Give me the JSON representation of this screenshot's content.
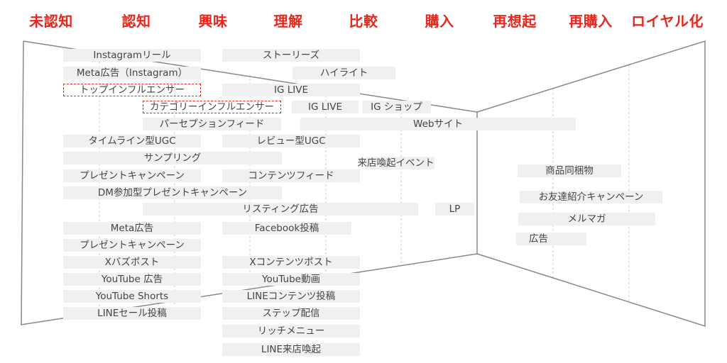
{
  "stages": [
    "未認知",
    "認知",
    "興味",
    "理解",
    "比較",
    "購入",
    "再想起",
    "再購入",
    "ロイヤル化"
  ],
  "stage_color": "#e8261c",
  "items": [
    "Instagramリール",
    "ストーリーズ",
    "Meta広告（Instagram）",
    "ハイライト",
    "トップインフルエンサー",
    "IG LIVE",
    "カテゴリーインフルエンサー",
    "IG LIVE",
    "IG ショップ",
    "パーセプションフィード",
    "Webサイト",
    "タイムライン型UGC",
    "レビュー型UGC",
    "サンプリング",
    "来店喚起イベント",
    "プレゼントキャンペーン",
    "コンテンツフィード",
    "DM参加型プレゼントキャンペーン",
    "リスティング広告",
    "LP",
    "Meta広告",
    "Facebook投稿",
    "プレゼントキャンペーン",
    "Xバズポスト",
    "Xコンテンツポスト",
    "YouTube 広告",
    "YouTube動画",
    "YouTube Shorts",
    "LINEコンテンツ投稿",
    "LINEセール投稿",
    "ステップ配信",
    "リッチメニュー",
    "LINE来店喚起"
  ],
  "retention_items": [
    "商品同梱物",
    "お友達紹介キャンペーン",
    "メルマガ",
    "広告"
  ],
  "highlighted_items": [
    "トップインフルエンサー",
    "カテゴリーインフルエンサー"
  ]
}
